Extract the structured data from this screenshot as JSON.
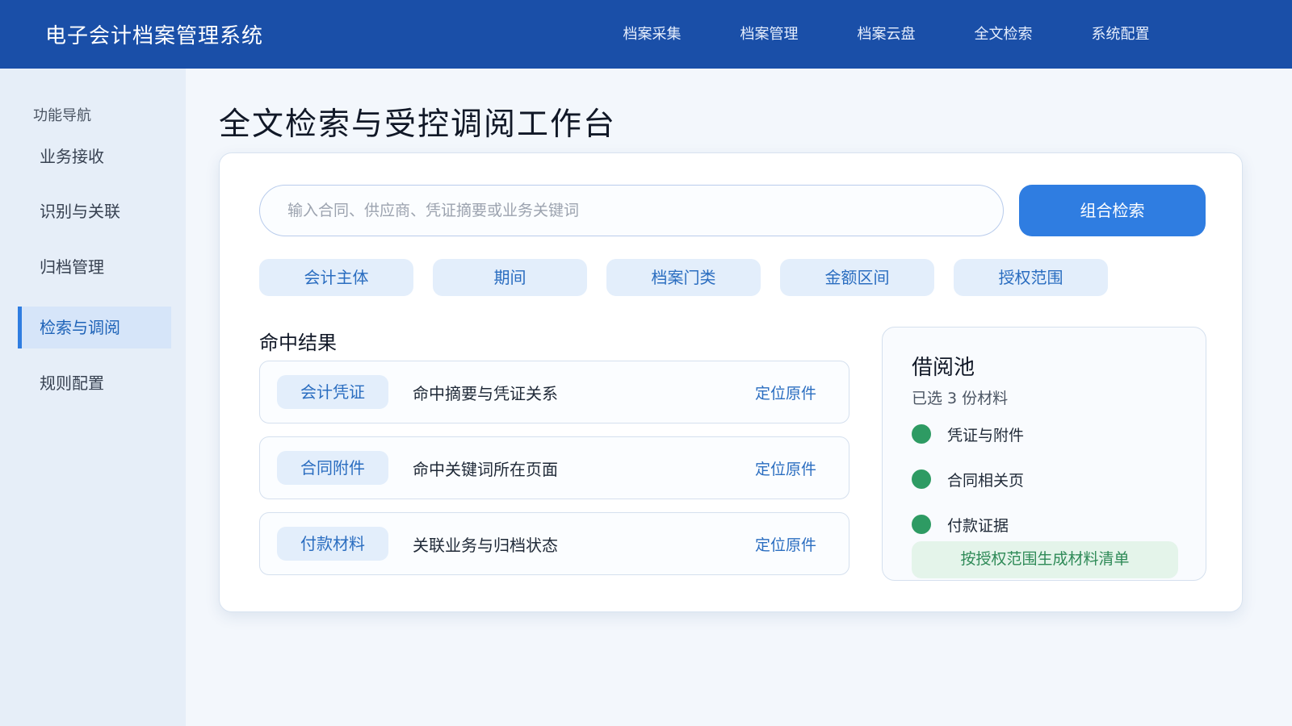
{
  "header": {
    "app_title": "电子会计档案管理系统",
    "nav": [
      "档案采集",
      "档案管理",
      "档案云盘",
      "全文检索",
      "系统配置"
    ]
  },
  "sidebar": {
    "heading": "功能导航",
    "items": [
      {
        "label": "业务接收",
        "active": false
      },
      {
        "label": "识别与关联",
        "active": false
      },
      {
        "label": "归档管理",
        "active": false
      },
      {
        "label": "检索与调阅",
        "active": true
      },
      {
        "label": "规则配置",
        "active": false
      }
    ]
  },
  "main": {
    "title": "全文检索与受控调阅工作台",
    "search": {
      "placeholder": "输入合同、供应商、凭证摘要或业务关键词",
      "button_label": "组合检索"
    },
    "filters": [
      "会计主体",
      "期间",
      "档案门类",
      "金额区间",
      "授权范围"
    ],
    "results": {
      "heading": "命中结果",
      "rows": [
        {
          "tag": "会计凭证",
          "desc": "命中摘要与凭证关系",
          "action": "定位原件"
        },
        {
          "tag": "合同附件",
          "desc": "命中关键词所在页面",
          "action": "定位原件"
        },
        {
          "tag": "付款材料",
          "desc": "关联业务与归档状态",
          "action": "定位原件"
        }
      ]
    },
    "borrow_pool": {
      "title": "借阅池",
      "count_text": "已选 3 份材料",
      "items": [
        "凭证与附件",
        "合同相关页",
        "付款证据"
      ],
      "button_label": "按授权范围生成材料清单"
    }
  },
  "colors": {
    "header_bg": "#1a4fa8",
    "accent": "#2f7de1",
    "success": "#2e9b63"
  }
}
